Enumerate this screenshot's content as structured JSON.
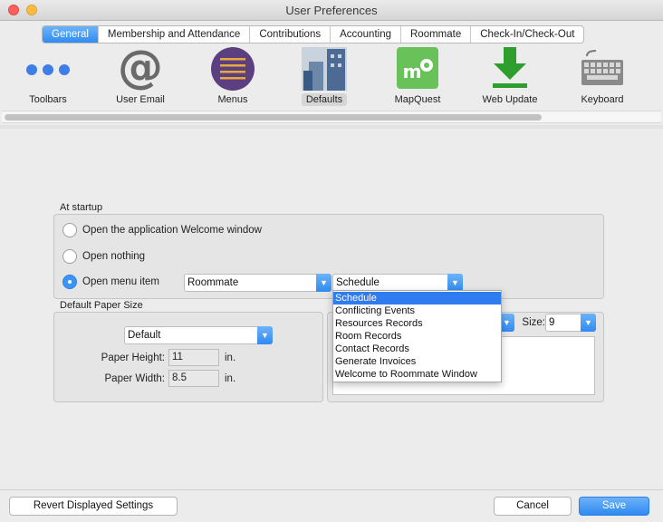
{
  "window": {
    "title": "User Preferences"
  },
  "tabs": [
    {
      "label": "General",
      "active": true
    },
    {
      "label": "Membership and Attendance"
    },
    {
      "label": "Contributions"
    },
    {
      "label": "Accounting"
    },
    {
      "label": "Roommate"
    },
    {
      "label": "Check-In/Check-Out"
    }
  ],
  "toolbar": {
    "items": [
      {
        "label": "Toolbars",
        "icon": "three-dots-icon"
      },
      {
        "label": "User Email",
        "icon": "at-sign-icon"
      },
      {
        "label": "Menus",
        "icon": "menu-lines-icon"
      },
      {
        "label": "Defaults",
        "icon": "building-icon",
        "selected": true
      },
      {
        "label": "MapQuest",
        "icon": "mapquest-icon"
      },
      {
        "label": "Web Update",
        "icon": "download-arrow-icon"
      },
      {
        "label": "Keyboard",
        "icon": "keyboard-icon"
      }
    ],
    "scroll_fraction": 0.82
  },
  "startup": {
    "heading": "At startup",
    "option_welcome": "Open the application Welcome window",
    "option_nothing": "Open nothing",
    "option_menu_item": "Open menu item",
    "selected_option": "Open menu item",
    "menu_value": "Roommate",
    "submenu_value": "Schedule"
  },
  "dropdown": {
    "items": [
      "Schedule",
      "Conflicting Events",
      "Resources Records",
      "Room Records",
      "Contact Records",
      "Generate Invoices",
      "Welcome to Roommate Window"
    ],
    "highlighted": "Schedule"
  },
  "paper": {
    "heading": "Default Paper Size",
    "size_value": "Default",
    "height_label": "Paper Height:",
    "height_value": "11",
    "width_label": "Paper Width:",
    "width_value": "8.5",
    "unit": "in."
  },
  "font": {
    "size_label": "Size:",
    "size_value": "9"
  },
  "buttons": {
    "revert": "Revert Displayed Settings",
    "cancel": "Cancel",
    "save": "Save"
  },
  "colors": {
    "accent": "#2f8af0",
    "highlight": "#2f7bf0",
    "menus_icon": "#5b3f7e",
    "mapquest_icon": "#69c15a",
    "web_update_icon": "#2e9e2e"
  }
}
